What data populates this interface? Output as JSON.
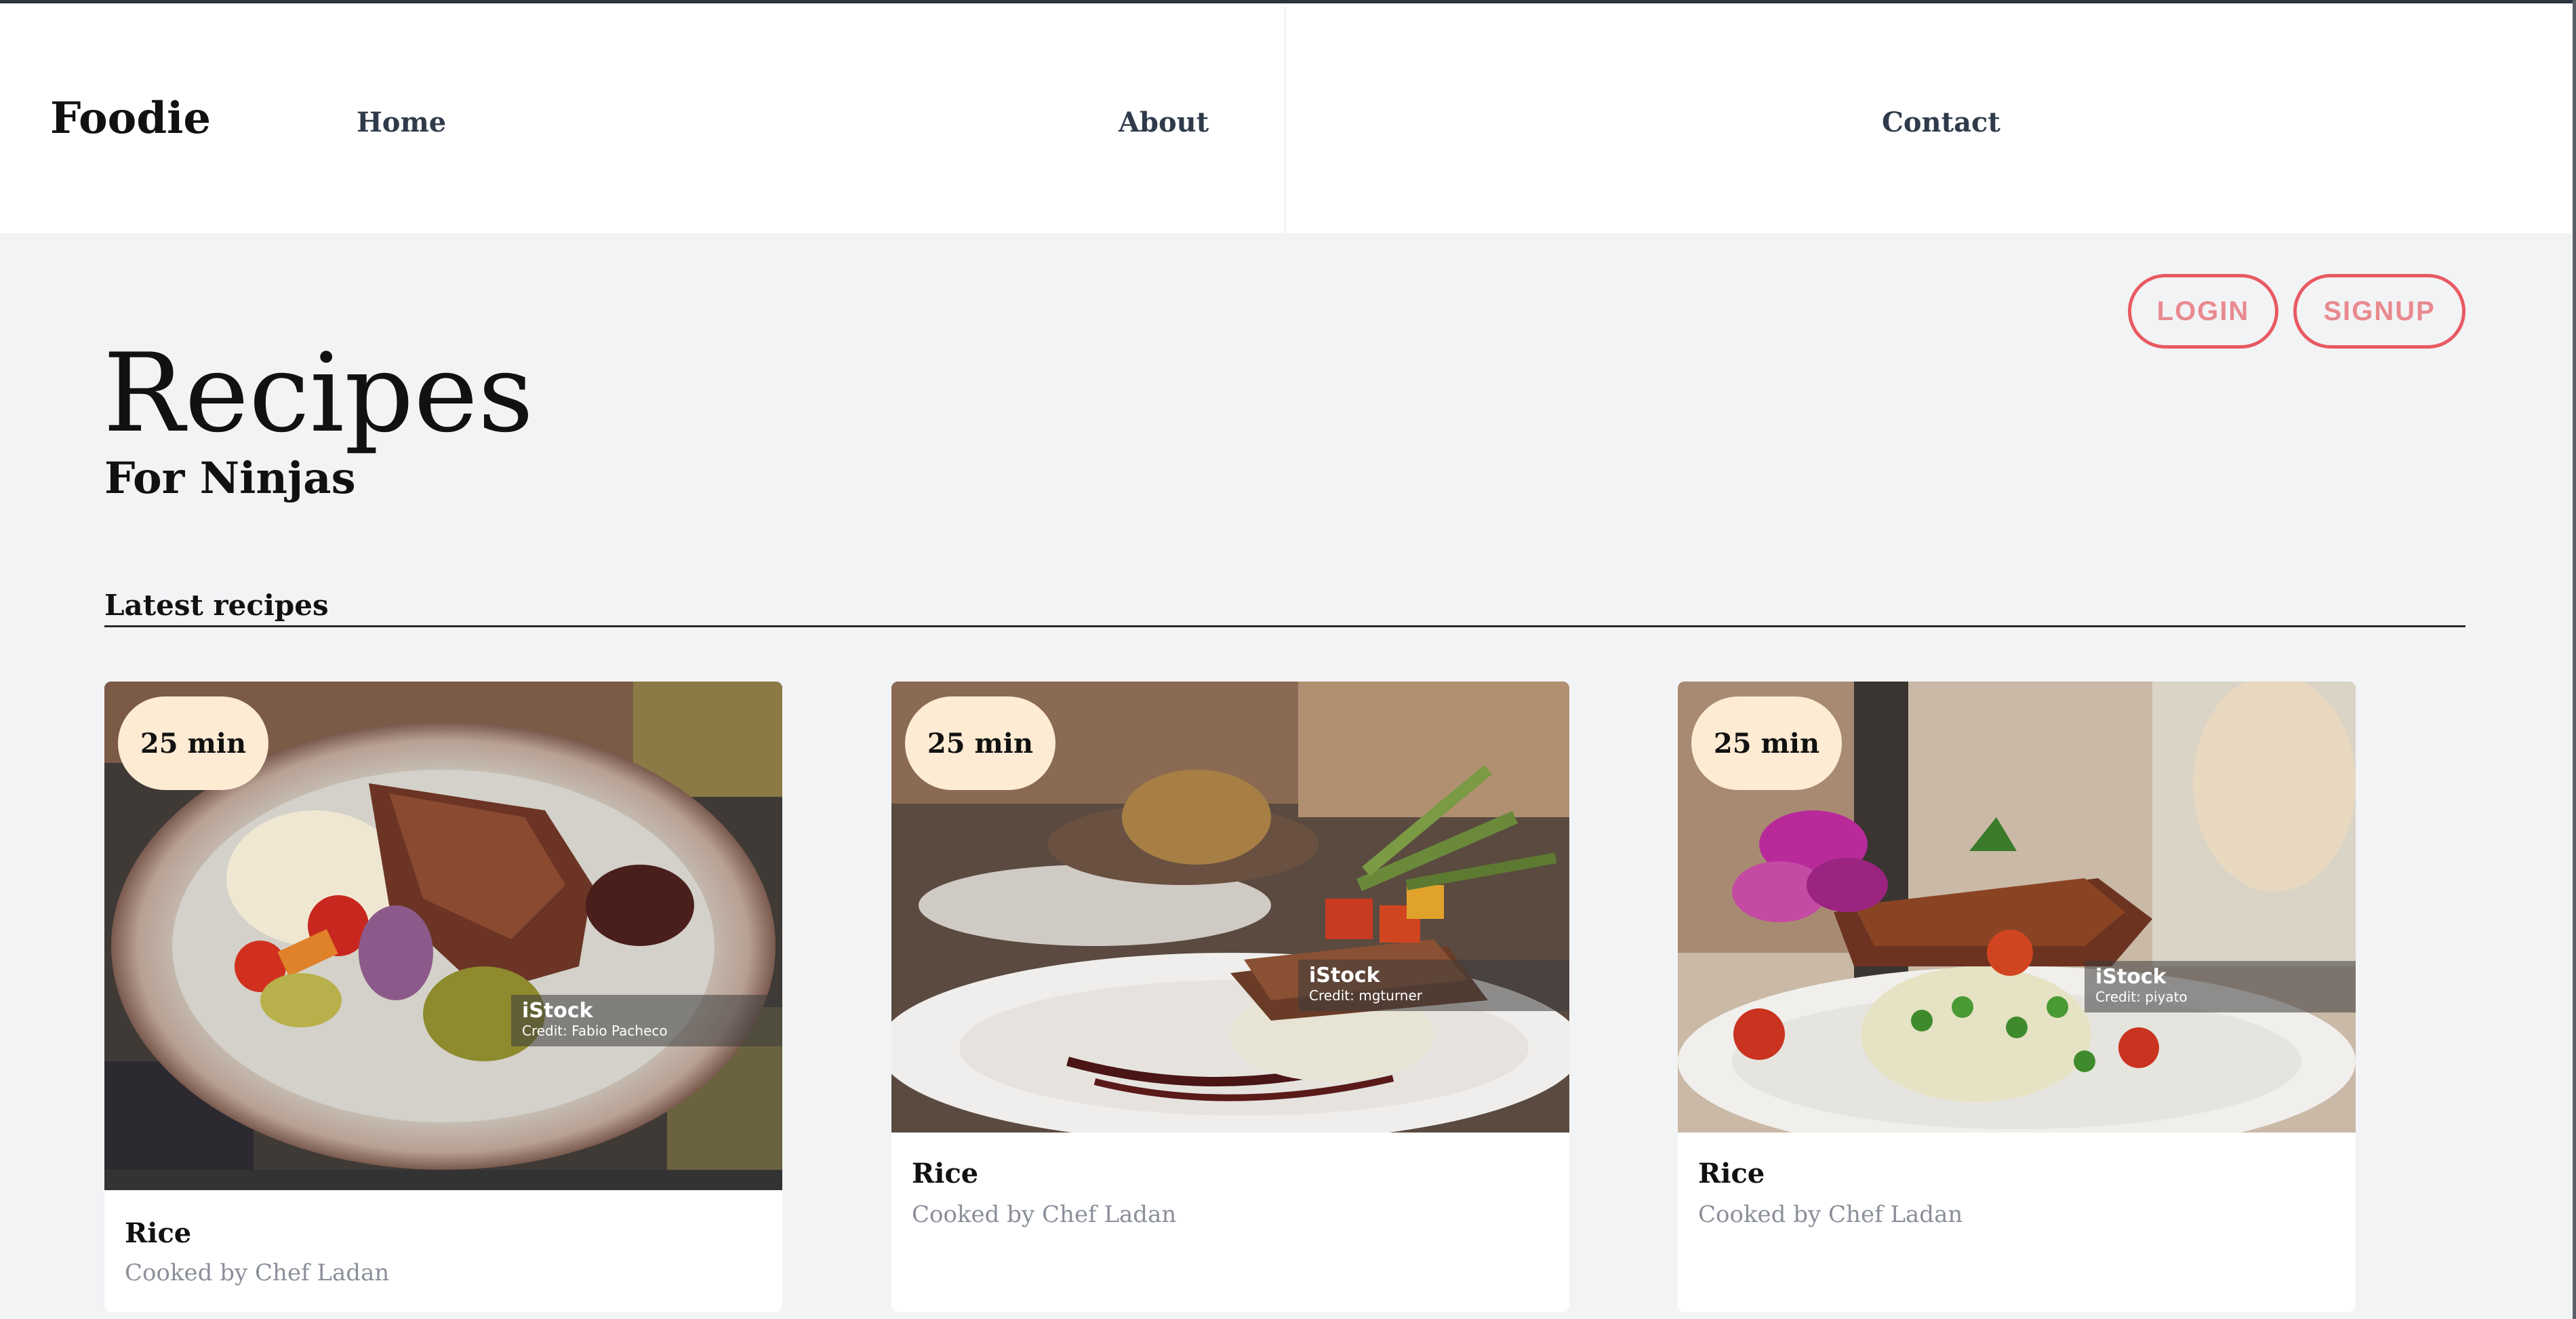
{
  "brand": "Foodie",
  "nav": {
    "home": "Home",
    "about": "About",
    "contact": "Contact"
  },
  "auth": {
    "login": "LOGIN",
    "signup": "SIGNUP"
  },
  "hero": {
    "title": "Recipes",
    "subtitle": "For Ninjas"
  },
  "section": {
    "title": "Latest recipes"
  },
  "colors": {
    "accent": "#e85a62",
    "badge": "#fdebd3",
    "background": "#f2f3f5"
  },
  "recipes": [
    {
      "time": "25 min",
      "title": "Rice",
      "author": "Cooked by Chef Ladan",
      "watermark_brand": "iStock",
      "watermark_credit": "Credit: Fabio Pacheco"
    },
    {
      "time": "25 min",
      "title": "Rice",
      "author": "Cooked by Chef Ladan",
      "watermark_brand": "iStock",
      "watermark_credit": "Credit: mgturner"
    },
    {
      "time": "25 min",
      "title": "Rice",
      "author": "Cooked by Chef Ladan",
      "watermark_brand": "iStock",
      "watermark_credit": "Credit: piyato"
    }
  ]
}
